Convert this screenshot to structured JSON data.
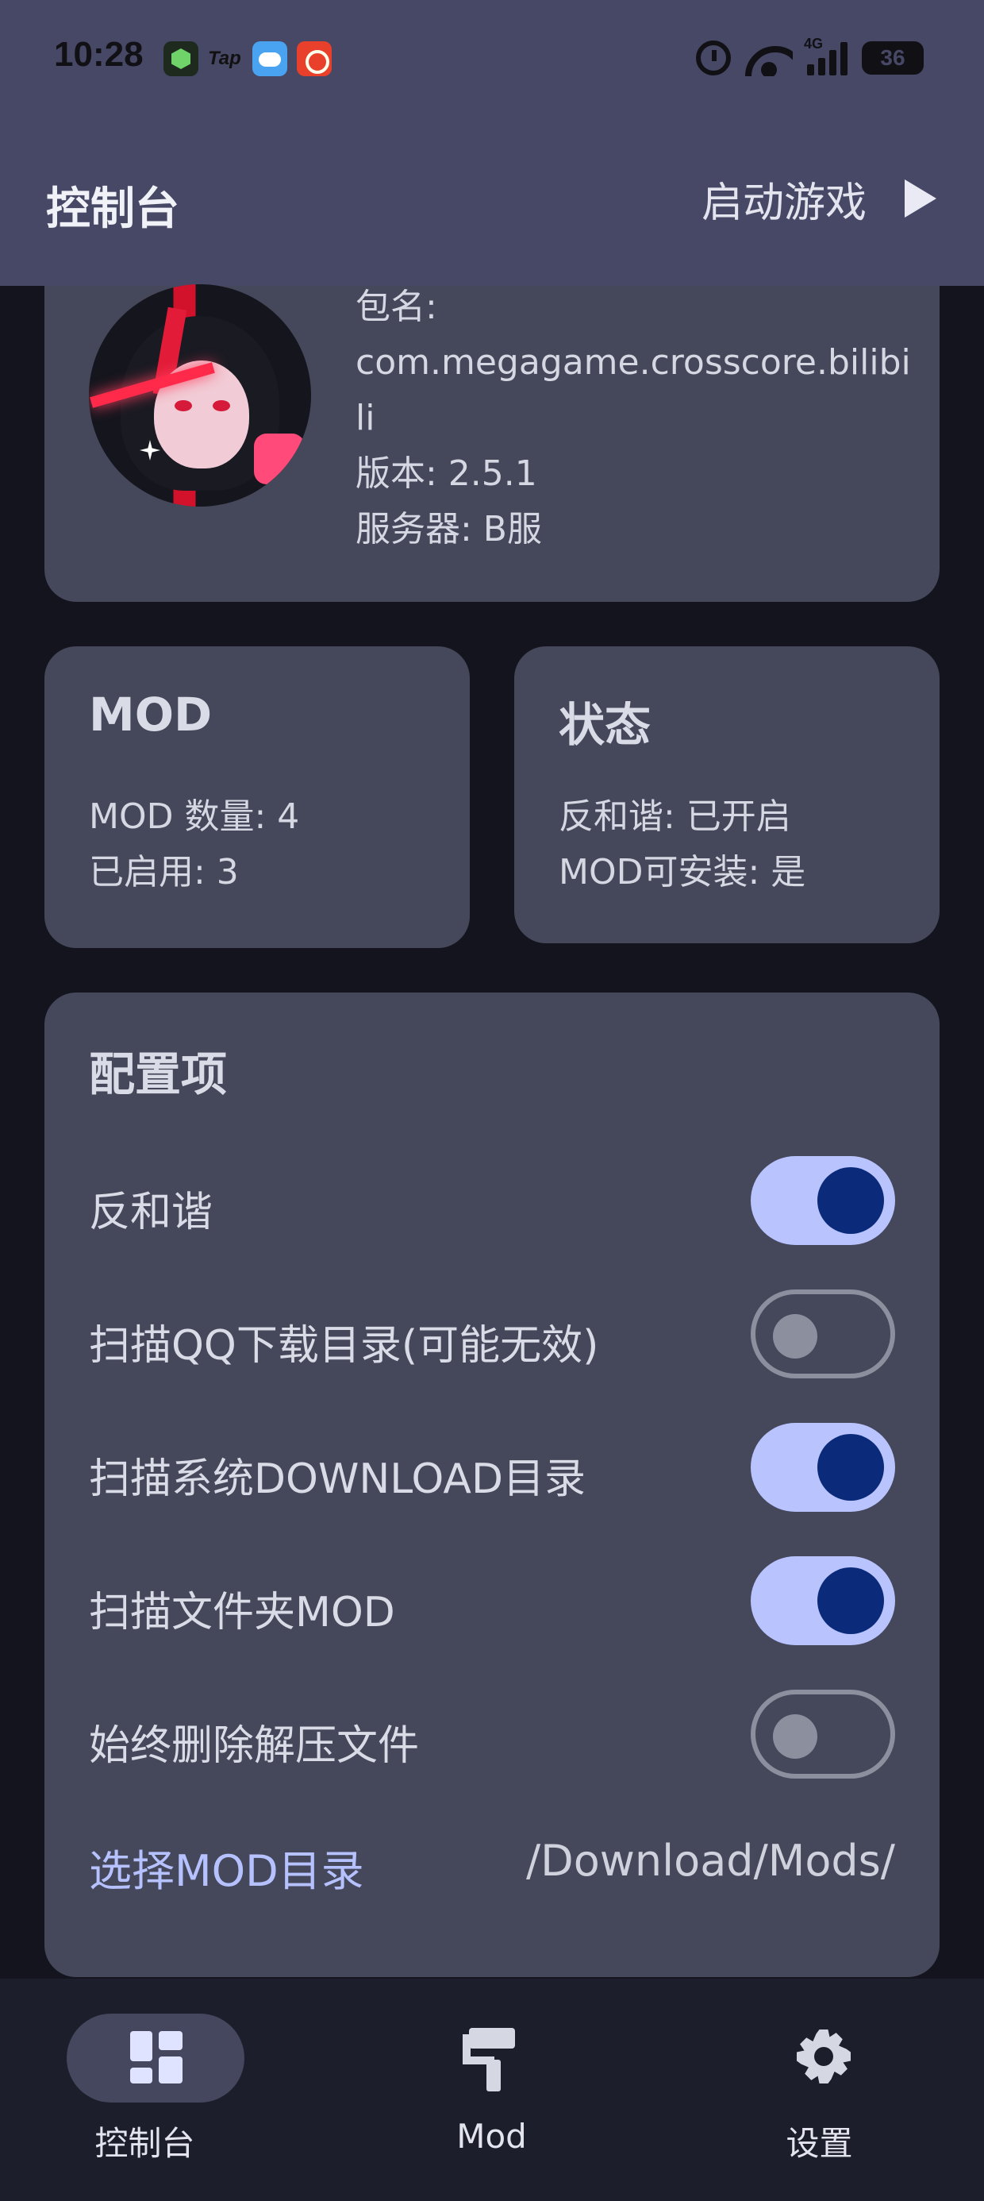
{
  "status_bar": {
    "time": "10:28",
    "notification_icons": [
      "cube-app-icon",
      "taptap-icon",
      "weather-icon",
      "red-app-icon"
    ],
    "taptap_text": "Tap",
    "network_type": "4G",
    "battery_level": "36"
  },
  "app_bar": {
    "title": "控制台",
    "launch_label": "启动游戏"
  },
  "info_card": {
    "package_label": "包名:",
    "package_name": "com.megagame.crosscore.bilibili",
    "version": "版本: 2.5.1",
    "server": "服务器: B服"
  },
  "mod_card": {
    "title": "MOD",
    "count": "MOD 数量: 4",
    "enabled": "已启用: 3"
  },
  "status_card": {
    "title": "状态",
    "anti_harmony": "反和谐: 已开启",
    "installable": "MOD可安装: 是"
  },
  "config_card": {
    "title": "配置项",
    "items": [
      {
        "label": "反和谐",
        "enabled": true
      },
      {
        "label": "扫描QQ下载目录(可能无效)",
        "enabled": false
      },
      {
        "label": "扫描系统DOWNLOAD目录",
        "enabled": true
      },
      {
        "label": "扫描文件夹MOD",
        "enabled": true
      },
      {
        "label": "始终删除解压文件",
        "enabled": false
      }
    ],
    "dir_link": "选择MOD目录",
    "dir_value": "/Download/Mods/"
  },
  "bottom_nav": {
    "items": [
      {
        "label": "控制台",
        "icon": "dashboard-icon",
        "selected": true
      },
      {
        "label": "Mod",
        "icon": "paint-roller-icon",
        "selected": false
      },
      {
        "label": "设置",
        "icon": "gear-icon",
        "selected": false
      }
    ]
  },
  "colors": {
    "top_bar": "#464866",
    "background": "#13141d",
    "card": "#45475a",
    "switch_on_track": "#b9c4ff",
    "switch_on_knob": "#0b2b7a",
    "link": "#b6c2ff"
  }
}
